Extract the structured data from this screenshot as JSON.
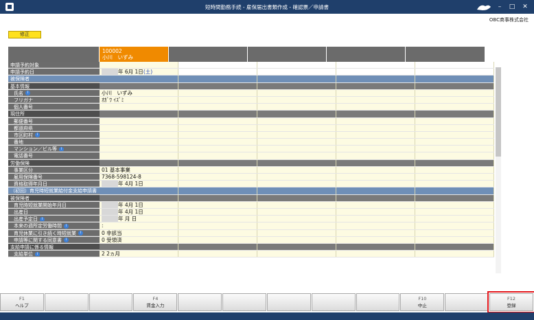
{
  "window": {
    "title": "短時間勤務手続 - 雇保届出書類作成 - 確認票／申請書"
  },
  "company": "OBC商事株式会社",
  "edit_badge": "修正",
  "employee": {
    "code": "100002",
    "name": "小川　いずみ"
  },
  "rows": [
    {
      "label": "申請予約対象",
      "type": "normal",
      "value": ""
    },
    {
      "label": "申請予約日",
      "type": "normal",
      "value": "年  6月  1日",
      "extra": "(土)"
    },
    {
      "label": "被保険者",
      "type": "blue",
      "value": ""
    },
    {
      "label": "基本情報",
      "type": "sec",
      "value": ""
    },
    {
      "label": "氏名",
      "type": "ind",
      "info": true,
      "value": "小川　いずみ"
    },
    {
      "label": "フリガナ",
      "type": "ind",
      "value": "ｵｶﾞﾜ ｲｽﾞﾐ"
    },
    {
      "label": "個人番号",
      "type": "ind",
      "value": ""
    },
    {
      "label": "現住所",
      "type": "sec",
      "value": ""
    },
    {
      "label": "郵便番号",
      "type": "ind",
      "value": ""
    },
    {
      "label": "都道府県",
      "type": "ind",
      "value": ""
    },
    {
      "label": "市区町村",
      "type": "ind",
      "info": true,
      "value": ""
    },
    {
      "label": "番地",
      "type": "ind",
      "value": ""
    },
    {
      "label": "マンション／ビル等",
      "type": "ind",
      "info": true,
      "value": ""
    },
    {
      "label": "電話番号",
      "type": "ind",
      "value": ""
    },
    {
      "label": "労働保険",
      "type": "sec",
      "value": ""
    },
    {
      "label": "事業区分",
      "type": "ind",
      "value": "01   基本事業"
    },
    {
      "label": "雇用保険番号",
      "type": "ind",
      "value": "7368-598124-8"
    },
    {
      "label": "資格取得年月日",
      "type": "ind",
      "value": "年  4月  1日"
    },
    {
      "label": "（初回）育児時短就業給付金支給申請書",
      "type": "blue",
      "value": ""
    },
    {
      "label": "被保険者",
      "type": "sec",
      "value": ""
    },
    {
      "label": "育児時短就業開始年月日",
      "type": "ind",
      "value": "年  4月  1日"
    },
    {
      "label": "出産日",
      "type": "ind",
      "value": "年  4月  1日"
    },
    {
      "label": "出産予定日",
      "type": "ind",
      "info": true,
      "value": "年    月    日"
    },
    {
      "label": "本来の週所定労働時間",
      "type": "ind",
      "info": true,
      "value": ":"
    },
    {
      "label": "育児休業に引き続く時短就業",
      "type": "ind",
      "info": true,
      "value": "0   非該当"
    },
    {
      "label": "申請等に関する同意書",
      "type": "ind",
      "info": true,
      "value": "0   受領済"
    },
    {
      "label": "支給申請に係る情報",
      "type": "sec",
      "value": ""
    },
    {
      "label": "支給単位",
      "type": "ind",
      "info": true,
      "value": "2   2ヵ月"
    }
  ],
  "fkeys": [
    {
      "key": "F1",
      "label": "ヘルプ"
    },
    {
      "key": "",
      "label": ""
    },
    {
      "key": "",
      "label": ""
    },
    {
      "key": "F4",
      "label": "賃金入力"
    },
    {
      "key": "",
      "label": ""
    },
    {
      "key": "",
      "label": ""
    },
    {
      "key": "",
      "label": ""
    },
    {
      "key": "",
      "label": ""
    },
    {
      "key": "",
      "label": ""
    },
    {
      "key": "F10",
      "label": "中止"
    },
    {
      "key": "",
      "label": ""
    },
    {
      "key": "F12",
      "label": "登録"
    }
  ]
}
